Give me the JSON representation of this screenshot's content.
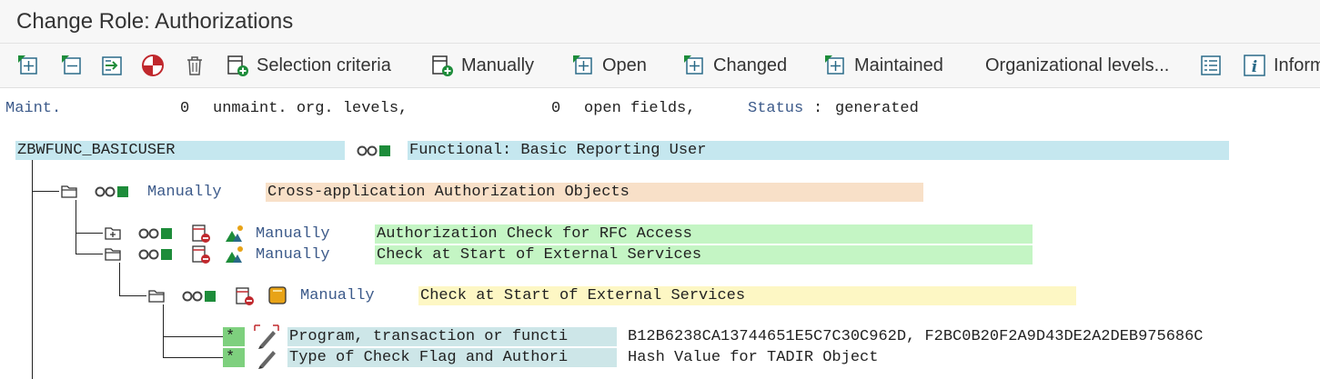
{
  "title": "Change Role: Authorizations",
  "toolbar": {
    "selection_criteria": "Selection criteria",
    "manually": "Manually",
    "open": "Open",
    "changed": "Changed",
    "maintained": "Maintained",
    "org_levels": "Organizational levels...",
    "information": "Information"
  },
  "status_line": {
    "maint_label": "Maint.",
    "unmaint_count": "0",
    "unmaint_text": "unmaint. org. levels,",
    "open_count": "0",
    "open_text": "open fields,",
    "status_label": "Status",
    "status_sep": ":",
    "status_value": "generated"
  },
  "tree": {
    "root": {
      "id": "ZBWFUNC_BASICUSER",
      "text": "Functional: Basic Reporting User"
    },
    "level1": {
      "status": "Manually",
      "text": "Cross-application Authorization Objects"
    },
    "level2": [
      {
        "status": "Manually",
        "text": "Authorization Check for RFC Access"
      },
      {
        "status": "Manually",
        "text": "Check at Start of External Services"
      }
    ],
    "level3": {
      "status": "Manually",
      "text": "Check at Start of External Services"
    },
    "fields": [
      {
        "marker": "*",
        "name": "Program, transaction or functi",
        "value": "B12B6238CA13744651E5C7C30C962D, F2BC0B20F2A9D43DE2A2DEB975686C"
      },
      {
        "marker": "*",
        "name": "Type of Check Flag and Authori",
        "value": "Hash Value for TADIR Object"
      }
    ]
  },
  "colors": {
    "root_bg": "#c5e7ef",
    "level1_bg": "#f8e0c8",
    "level2_bg": "#c4f5c4",
    "level3_bg": "#fdf7c4",
    "field_bg": "#cde6e8",
    "marker_bg": "#7ed07e",
    "link_blue": "#3c5a8a",
    "status_green": "#1d8c3a"
  }
}
